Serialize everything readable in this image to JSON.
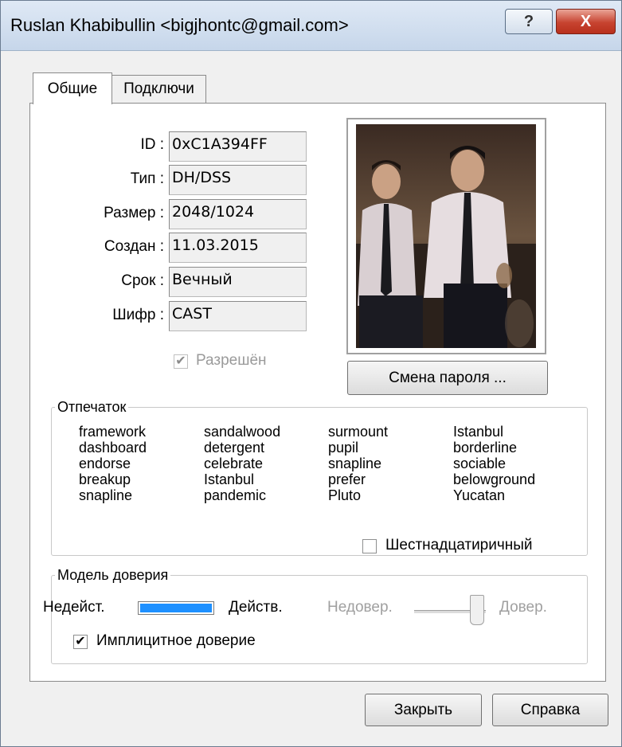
{
  "window": {
    "title": "Ruslan Khabibullin <bigjhontc@gmail.com>",
    "help_symbol": "?",
    "close_symbol": "X"
  },
  "tabs": [
    {
      "label": "Общие"
    },
    {
      "label": "Подключи"
    }
  ],
  "fields": [
    {
      "label": "ID :",
      "value": "0xC1A394FF"
    },
    {
      "label": "Тип :",
      "value": "DH/DSS"
    },
    {
      "label": "Размер :",
      "value": "2048/1024"
    },
    {
      "label": "Создан :",
      "value": "11.03.2015"
    },
    {
      "label": "Срок :",
      "value": "Вечный"
    },
    {
      "label": "Шифр :",
      "value": "CAST"
    }
  ],
  "enabled": {
    "label": "Разрешён",
    "checked": true,
    "disabled": true
  },
  "change_password_label": "Смена пароля ...",
  "fingerprint": {
    "label": "Отпечаток",
    "columns": [
      [
        "framework",
        "dashboard",
        "endorse",
        "breakup",
        "snapline"
      ],
      [
        "sandalwood",
        "detergent",
        "celebrate",
        "Istanbul",
        "pandemic"
      ],
      [
        "surmount",
        "pupil",
        "snapline",
        "prefer",
        "Pluto"
      ],
      [
        "Istanbul",
        "borderline",
        "sociable",
        "belowground",
        "Yucatan"
      ]
    ],
    "hex_label": "Шестнадцатиричный",
    "hex_checked": false
  },
  "trust": {
    "label": "Модель доверия",
    "invalid_label": "Недейст.",
    "valid_label": "Действ.",
    "untrusted_label": "Недовер.",
    "trusted_label": "Довер.",
    "validity_color": "#1e90ff",
    "implicit_label": "Имплицитное доверие",
    "implicit_checked": true
  },
  "buttons": {
    "close": "Закрыть",
    "help": "Справка"
  },
  "colors": {
    "title_gradient_top": "#dfe9f5",
    "close_button": "#c74330",
    "validity_bar": "#1e90ff"
  }
}
